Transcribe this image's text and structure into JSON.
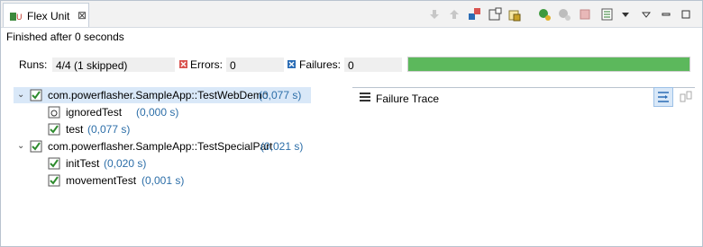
{
  "tab": {
    "title": "Flex Unit",
    "close_glyph": "⊠"
  },
  "toolbar": {
    "icons": [
      "arrow-down-icon",
      "arrow-up-icon",
      "failures-only-icon",
      "scroll-lock-icon",
      "history-icon",
      "rerun-icon",
      "rerun-failed-icon",
      "stop-icon",
      "layout-icon",
      "view-menu-icon",
      "minimize-icon",
      "maximize-icon"
    ]
  },
  "status": {
    "text": "Finished after 0 seconds"
  },
  "counters": {
    "runs_label": "Runs:",
    "runs_value": "4/4 (1 skipped)",
    "errors_label": "Errors:",
    "errors_value": "0",
    "failures_label": "Failures:",
    "failures_value": "0"
  },
  "progress": {
    "fraction": 1.0,
    "color": "#5cb85c"
  },
  "tree": [
    {
      "name": "com.powerflasher.SampleApp::TestWebDemo",
      "time": "(0,077 s)",
      "level": 0,
      "expanded": true,
      "selected": true,
      "type": "suite"
    },
    {
      "name": "ignoredTest",
      "time": "(0,000 s)",
      "level": 1,
      "type": "ignored"
    },
    {
      "name": "test",
      "time": "(0,077 s)",
      "level": 1,
      "type": "passed"
    },
    {
      "name": "com.powerflasher.SampleApp::TestSpecialPart",
      "time": "(0,021 s)",
      "level": 0,
      "expanded": true,
      "selected": false,
      "type": "suite"
    },
    {
      "name": "initTest",
      "time": "(0,020 s)",
      "level": 1,
      "type": "passed"
    },
    {
      "name": "movementTest",
      "time": "(0,001 s)",
      "level": 1,
      "type": "passed"
    }
  ],
  "failure_trace": {
    "title": "Failure Trace"
  },
  "colors": {
    "accent": "#2c6ea8",
    "selection": "#d9e8f8",
    "success": "#5cb85c",
    "error": "#d9534f"
  }
}
